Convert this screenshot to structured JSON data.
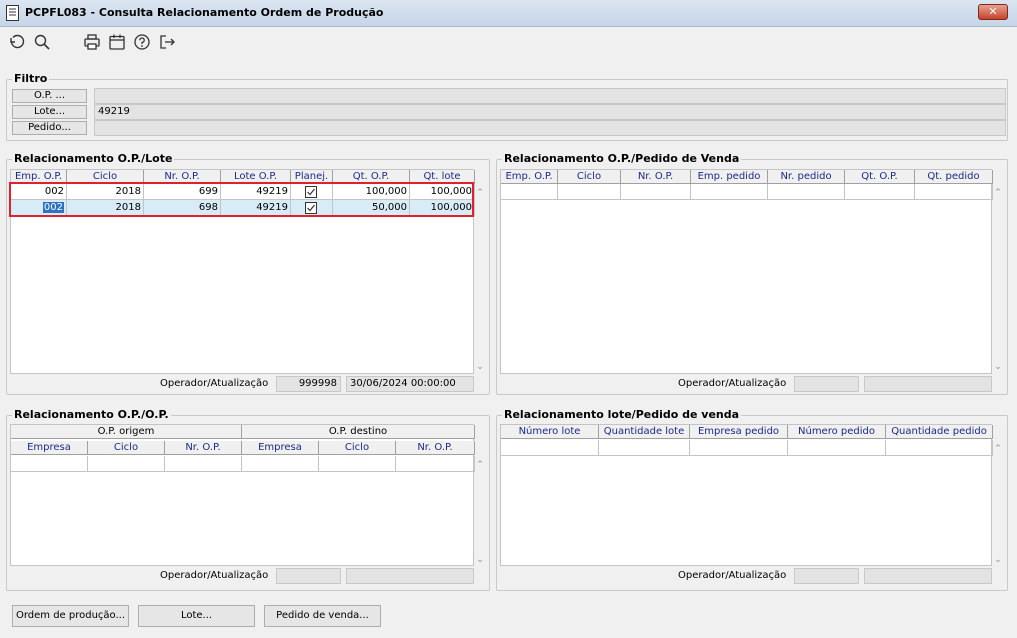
{
  "window": {
    "title": "PCPFL083 - Consulta Relacionamento Ordem de Produção",
    "close_label": "✕"
  },
  "toolbar": {
    "icons": [
      "undo-icon",
      "search-icon",
      "print-icon",
      "calendar-icon",
      "help-icon",
      "exit-icon"
    ]
  },
  "filtro": {
    "title": "Filtro",
    "op_button": "O.P. ...",
    "lote_button": "Lote...",
    "pedido_button": "Pedido...",
    "op_value": "",
    "lote_value": "49219",
    "pedido_value": ""
  },
  "op_lote": {
    "title": "Relacionamento O.P./Lote",
    "columns": [
      "Emp. O.P.",
      "Ciclo",
      "Nr. O.P.",
      "Lote O.P.",
      "Planej.",
      "Qt. O.P.",
      "Qt. lote"
    ],
    "rows": [
      {
        "emp": "002",
        "ciclo": "2018",
        "nr_op": "699",
        "lote_op": "49219",
        "planej": true,
        "qt_op": "100,000",
        "qt_lote": "100,000"
      },
      {
        "emp": "002",
        "ciclo": "2018",
        "nr_op": "698",
        "lote_op": "49219",
        "planej": true,
        "qt_op": "50,000",
        "qt_lote": "100,000"
      }
    ],
    "operador_label": "Operador/Atualização",
    "operador_value": "999998",
    "atualizacao_value": "30/06/2024 00:00:00"
  },
  "op_pedido": {
    "title": "Relacionamento O.P./Pedido de Venda",
    "columns": [
      "Emp. O.P.",
      "Ciclo",
      "Nr. O.P.",
      "Emp. pedido",
      "Nr. pedido",
      "Qt. O.P.",
      "Qt. pedido"
    ],
    "operador_label": "Operador/Atualização",
    "operador_value": "",
    "atualizacao_value": ""
  },
  "op_op": {
    "title": "Relacionamento O.P./O.P.",
    "group_origem": "O.P. origem",
    "group_destino": "O.P. destino",
    "columns": [
      "Empresa",
      "Ciclo",
      "Nr. O.P.",
      "Empresa",
      "Ciclo",
      "Nr. O.P."
    ],
    "operador_label": "Operador/Atualização",
    "operador_value": "",
    "atualizacao_value": ""
  },
  "lote_pedido": {
    "title": "Relacionamento lote/Pedido de venda",
    "columns": [
      "Número lote",
      "Quantidade lote",
      "Empresa pedido",
      "Número pedido",
      "Quantidade pedido"
    ],
    "operador_label": "Operador/Atualização",
    "operador_value": "",
    "atualizacao_value": ""
  },
  "bottom_buttons": {
    "ordem_producao": "Ordem de produção...",
    "lote": "Lote...",
    "pedido_venda": "Pedido de venda..."
  },
  "colors": {
    "highlight_border": "#e0202a",
    "header_text": "#1a2a8c",
    "selected_row": "#d7ecf7"
  }
}
